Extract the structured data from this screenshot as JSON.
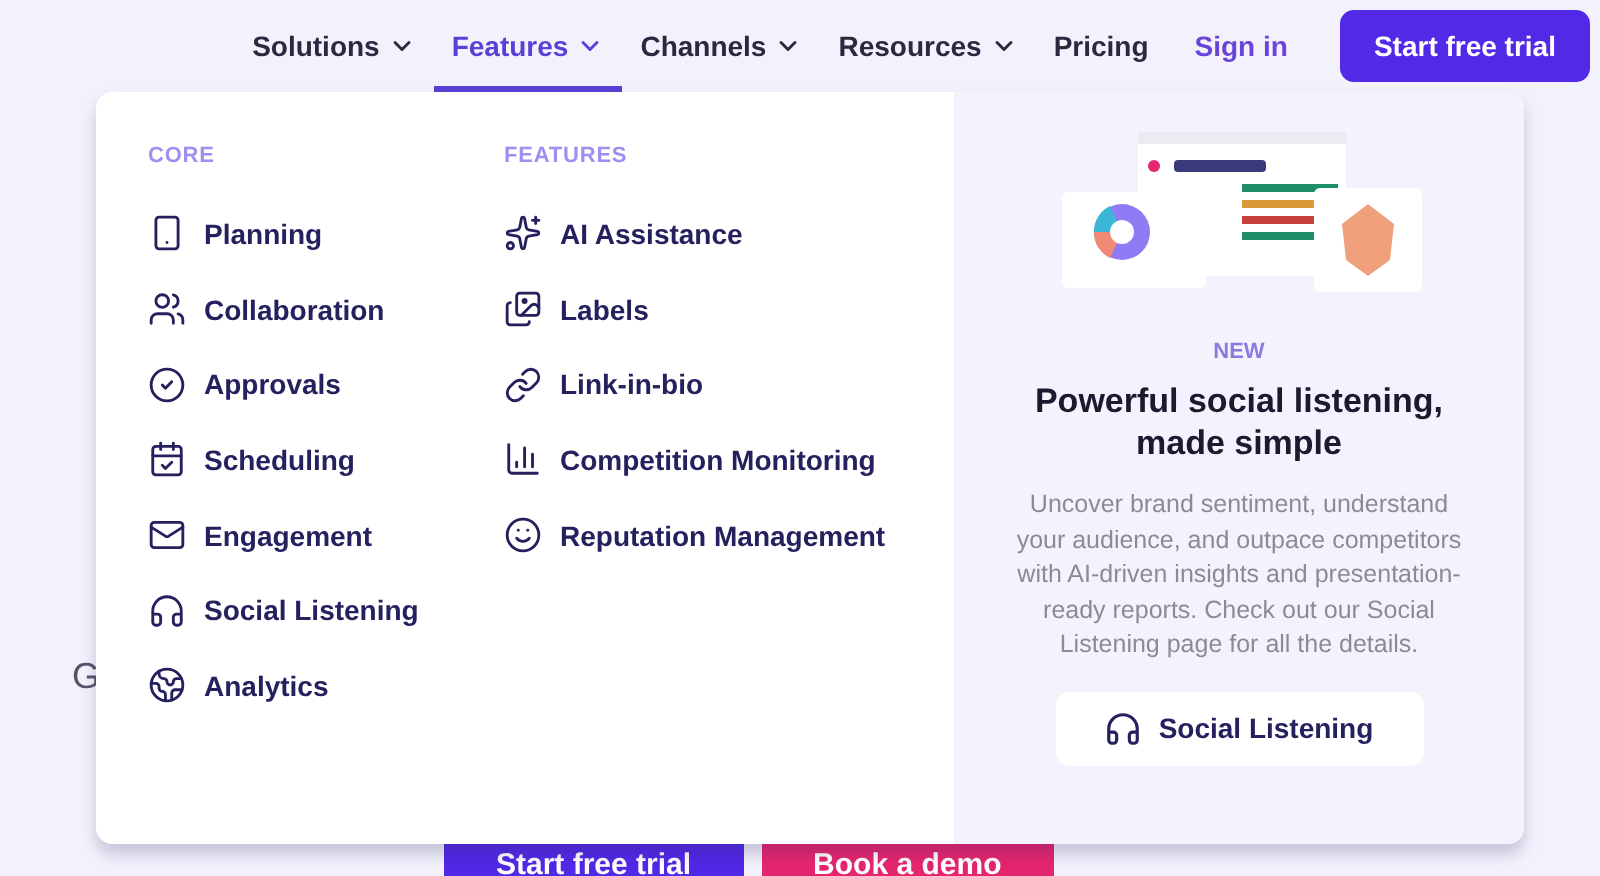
{
  "nav": {
    "items": [
      {
        "label": "Solutions",
        "kind": "dropdown",
        "selected": false
      },
      {
        "label": "Features",
        "kind": "dropdown",
        "selected": true
      },
      {
        "label": "Channels",
        "kind": "dropdown",
        "selected": false
      },
      {
        "label": "Resources",
        "kind": "dropdown",
        "selected": false
      },
      {
        "label": "Pricing",
        "kind": "link",
        "selected": false
      }
    ],
    "sign_in": "Sign in",
    "cta": "Start free trial"
  },
  "menu": {
    "columns": [
      {
        "heading": "CORE",
        "items": [
          {
            "label": "Planning"
          },
          {
            "label": "Collaboration"
          },
          {
            "label": "Approvals"
          },
          {
            "label": "Scheduling"
          },
          {
            "label": "Engagement"
          },
          {
            "label": "Social Listening"
          },
          {
            "label": "Analytics"
          }
        ]
      },
      {
        "heading": "FEATURES",
        "items": [
          {
            "label": "AI Assistance"
          },
          {
            "label": "Labels"
          },
          {
            "label": "Link-in-bio"
          },
          {
            "label": "Competition Monitoring"
          },
          {
            "label": "Reputation Management"
          }
        ]
      }
    ],
    "promo": {
      "badge": "NEW",
      "title": "Powerful social listening, made simple",
      "body": "Uncover brand sentiment, understand your audience, and outpace competitors with AI-driven insights and presentation-ready reports. Check out our Social Listening page for all the details.",
      "button": "Social Listening"
    }
  },
  "hero": {
    "heading_fragment": "G",
    "buttons": [
      {
        "label": "Start free trial",
        "kind": "primary"
      },
      {
        "label": "Book a demo",
        "kind": "secondary"
      }
    ]
  }
}
